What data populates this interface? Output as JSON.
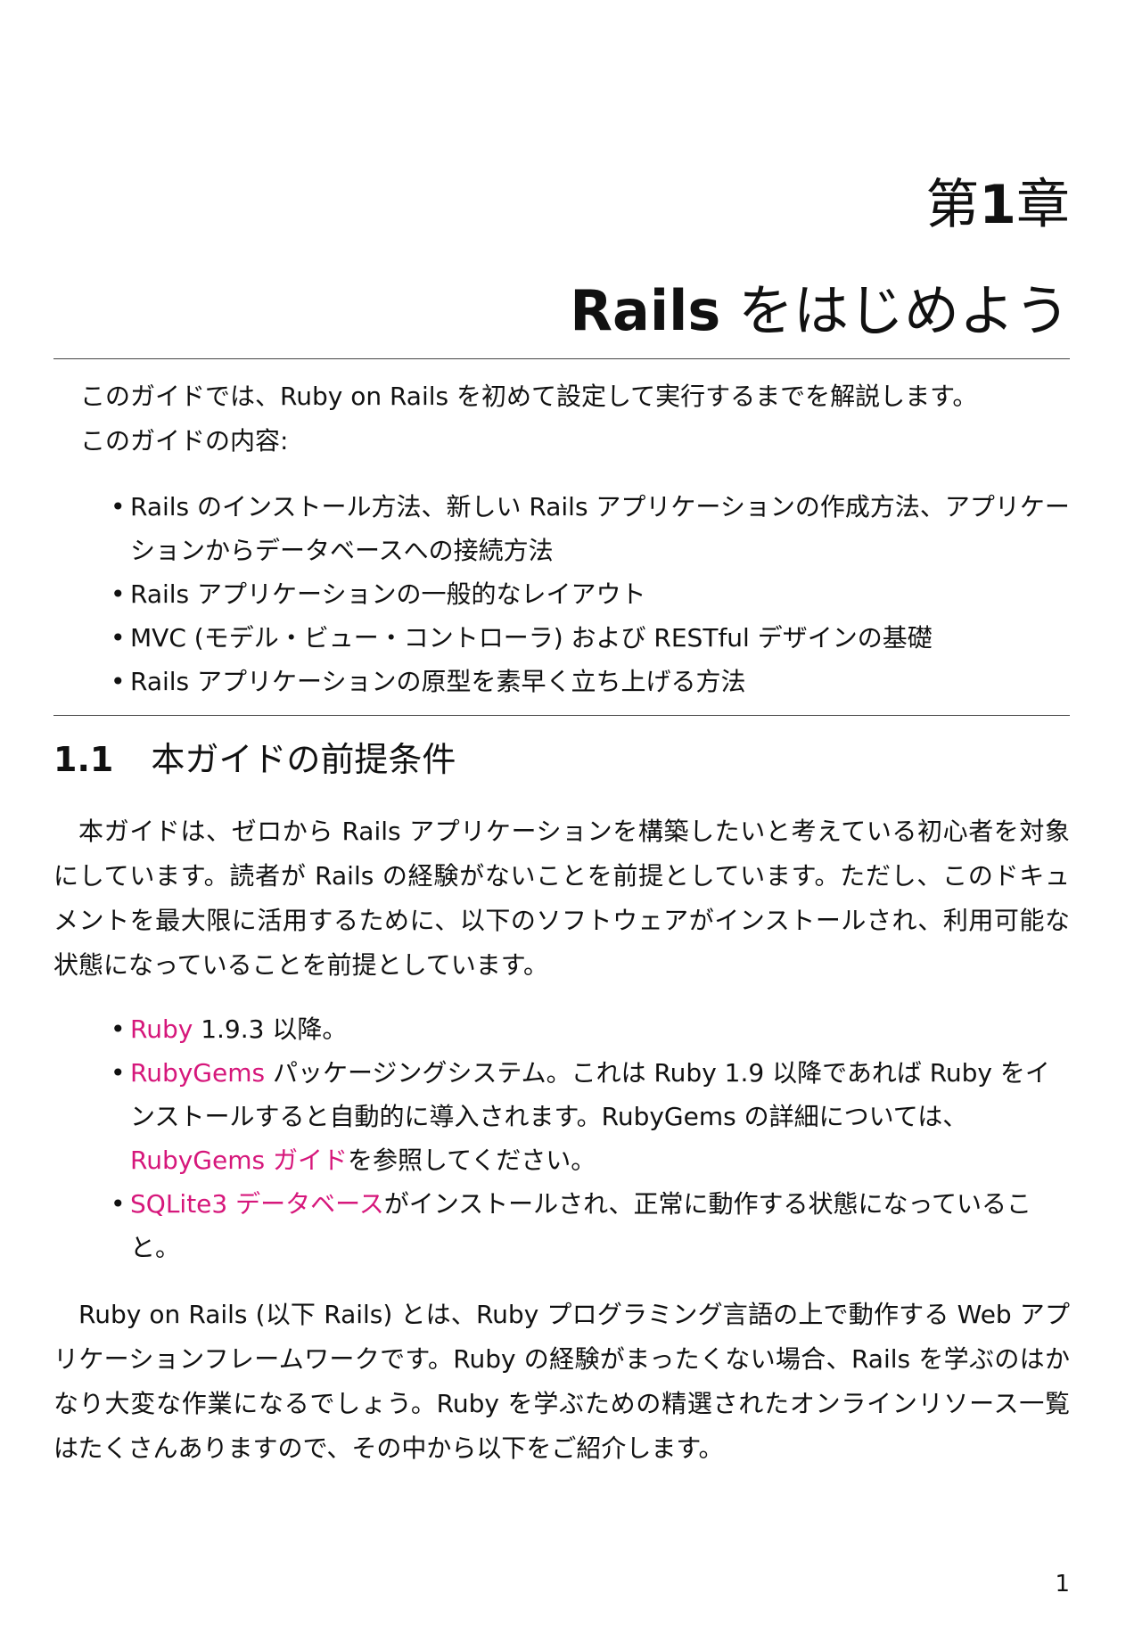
{
  "chapter": {
    "prefix": "第",
    "number": "1",
    "suffix": "章",
    "title_en": "Rails",
    "title_ja": " をはじめよう"
  },
  "intro": {
    "lead": "このガイドでは、Ruby on Rails を初めて設定して実行するまでを解説します。",
    "contents_label": "このガイドの内容:",
    "items": [
      "Rails のインストール方法、新しい Rails アプリケーションの作成方法、アプリケーションからデータベースへの接続方法",
      "Rails アプリケーションの一般的なレイアウト",
      "MVC (モデル・ビュー・コントローラ) および RESTful デザインの基礎",
      "Rails アプリケーションの原型を素早く立ち上げる方法"
    ]
  },
  "section": {
    "number": "1.1",
    "title": "本ガイドの前提条件",
    "para1": "本ガイドは、ゼロから Rails アプリケーションを構築したいと考えている初心者を対象にしています。読者が Rails の経験がないことを前提としています。ただし、このドキュメントを最大限に活用するために、以下のソフトウェアがインストールされ、利用可能な状態になっていることを前提としています。",
    "requirements": [
      {
        "link": "Ruby",
        "text": " 1.9.3 以降。"
      },
      {
        "link": "RubyGems",
        "text": " パッケージングシステム。これは Ruby 1.9 以降であれば Ruby をインストールすると自動的に導入されます。RubyGems の詳細については、",
        "link2": "RubyGems ガイド",
        "text2": "を参照してください。"
      },
      {
        "link": "SQLite3 データベース",
        "text": "がインストールされ、正常に動作する状態になっていること。"
      }
    ],
    "para2": "Ruby on Rails (以下 Rails) とは、Ruby プログラミング言語の上で動作する Web アプリケーションフレームワークです。Ruby の経験がまったくない場合、Rails を学ぶのはかなり大変な作業になるでしょう。Ruby を学ぶための精選されたオンラインリソース一覧はたくさんありますので、その中から以下をご紹介します。"
  },
  "page_number": "1",
  "colors": {
    "link": "#d6177b",
    "text": "#111111",
    "rule": "#444444"
  }
}
